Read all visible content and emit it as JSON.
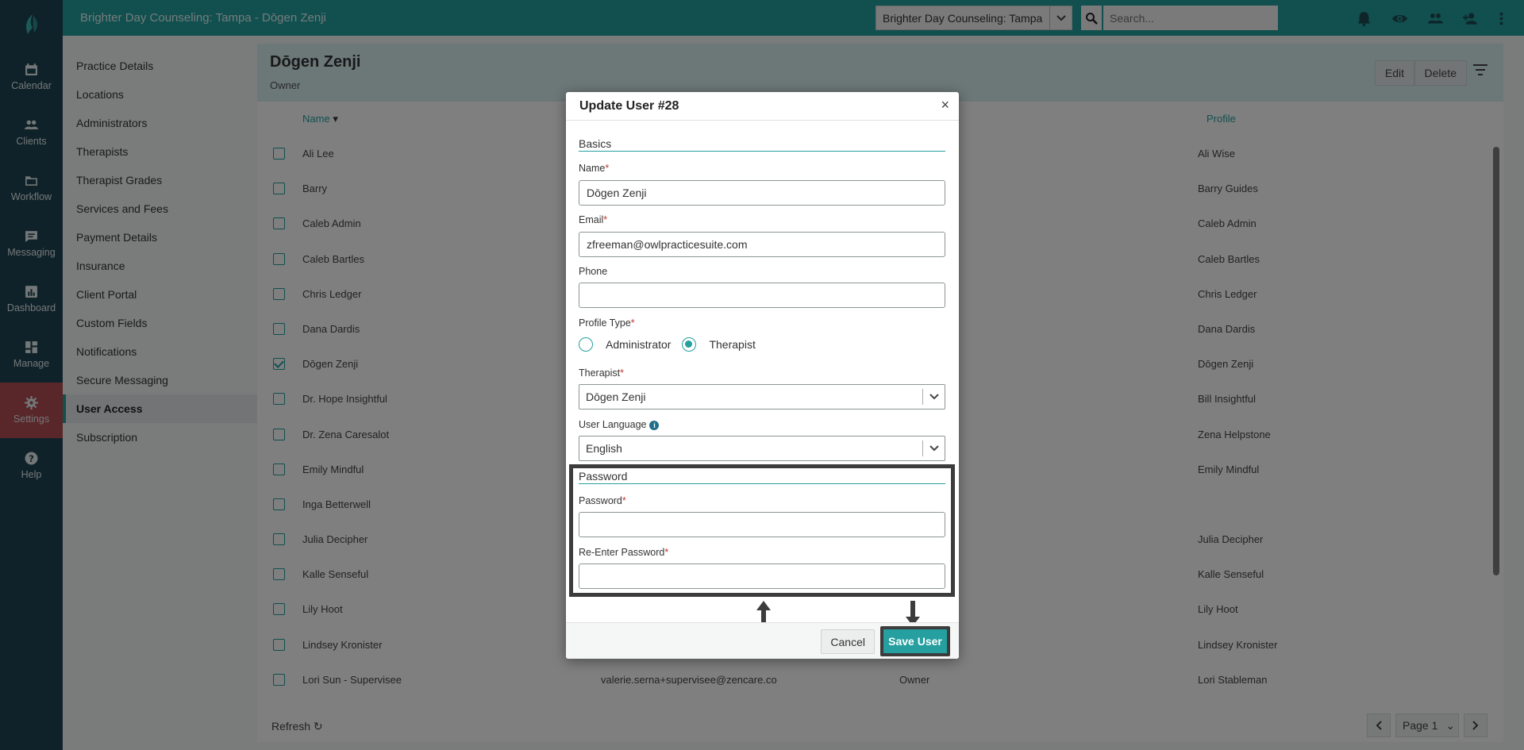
{
  "app": {
    "title": "Brighter Day Counseling: Tampa - Dōgen Zenji",
    "practice_select": "Brighter Day Counseling: Tampa",
    "search_placeholder": "Search..."
  },
  "rail": [
    {
      "label": "Calendar",
      "icon": "calendar-icon"
    },
    {
      "label": "Clients",
      "icon": "clients-icon"
    },
    {
      "label": "Workflow",
      "icon": "folder-icon"
    },
    {
      "label": "Messaging",
      "icon": "messaging-icon"
    },
    {
      "label": "Dashboard",
      "icon": "dashboard-icon"
    },
    {
      "label": "Manage",
      "icon": "manage-icon"
    },
    {
      "label": "Settings",
      "icon": "gear-icon"
    },
    {
      "label": "Help",
      "icon": "help-icon"
    }
  ],
  "settings_nav": [
    "Practice Details",
    "Locations",
    "Administrators",
    "Therapists",
    "Therapist Grades",
    "Services and Fees",
    "Payment Details",
    "Insurance",
    "Client Portal",
    "Custom Fields",
    "Notifications",
    "Secure Messaging",
    "User Access",
    "Subscription"
  ],
  "header": {
    "name": "Dōgen Zenji",
    "role": "Owner",
    "edit_label": "Edit",
    "delete_label": "Delete"
  },
  "table": {
    "col_name": "Name",
    "col_profile": "Profile",
    "rows": [
      {
        "name": "Ali Lee",
        "profile": "Ali Wise",
        "checked": false
      },
      {
        "name": "Barry",
        "profile": "Barry Guides",
        "checked": false
      },
      {
        "name": "Caleb Admin",
        "profile": "Caleb Admin",
        "checked": false
      },
      {
        "name": "Caleb Bartles",
        "profile": "Caleb Bartles",
        "checked": false
      },
      {
        "name": "Chris Ledger",
        "profile": "Chris Ledger",
        "checked": false
      },
      {
        "name": "Dana Dardis",
        "profile": "Dana Dardis",
        "checked": false
      },
      {
        "name": "Dōgen Zenji",
        "profile": "Dōgen Zenji",
        "checked": true
      },
      {
        "name": "Dr. Hope Insightful",
        "profile": "Bill Insightful",
        "checked": false
      },
      {
        "name": "Dr. Zena Caresalot",
        "profile": "Zena Helpstone",
        "checked": false
      },
      {
        "name": "Emily Mindful",
        "profile": "Emily Mindful",
        "checked": false
      },
      {
        "name": "Inga Betterwell",
        "profile": "",
        "checked": false
      },
      {
        "name": "Julia Decipher",
        "profile": "Julia Decipher",
        "checked": false
      },
      {
        "name": "Kalle Senseful",
        "profile": "Kalle Senseful",
        "checked": false
      },
      {
        "name": "Lily Hoot",
        "profile": "Lily Hoot",
        "checked": false
      },
      {
        "name": "Lindsey Kronister",
        "profile": "Lindsey Kronister",
        "checked": false
      },
      {
        "name": "Lori Sun - Supervisee",
        "email": "valerie.serna+supervisee@zencare.co",
        "type": "Owner",
        "profile": "Lori Stableman",
        "checked": false
      }
    ]
  },
  "footer": {
    "refresh_label": "Refresh",
    "page_label": "Page 1"
  },
  "modal": {
    "title": "Update User #28",
    "close": "×",
    "basics_title": "Basics",
    "name_label": "Name",
    "name_value": "Dōgen Zenji",
    "email_label": "Email",
    "email_value": "zfreeman@owlpracticesuite.com",
    "phone_label": "Phone",
    "phone_value": "",
    "profile_type_label": "Profile Type",
    "profile_type_options": [
      "Administrator",
      "Therapist"
    ],
    "profile_type_selected": "Therapist",
    "therapist_label": "Therapist",
    "therapist_value": "Dōgen Zenji",
    "language_label": "User Language",
    "language_value": "English",
    "password_title": "Password",
    "password_label": "Password",
    "reenter_label": "Re-Enter Password",
    "required_mark": "*",
    "cancel_label": "Cancel",
    "save_label": "Save User"
  },
  "colors": {
    "teal": "#259f9f",
    "rail": "#1f4552",
    "settings_active": "#b34d55",
    "highlight": "#3c3c3c"
  }
}
